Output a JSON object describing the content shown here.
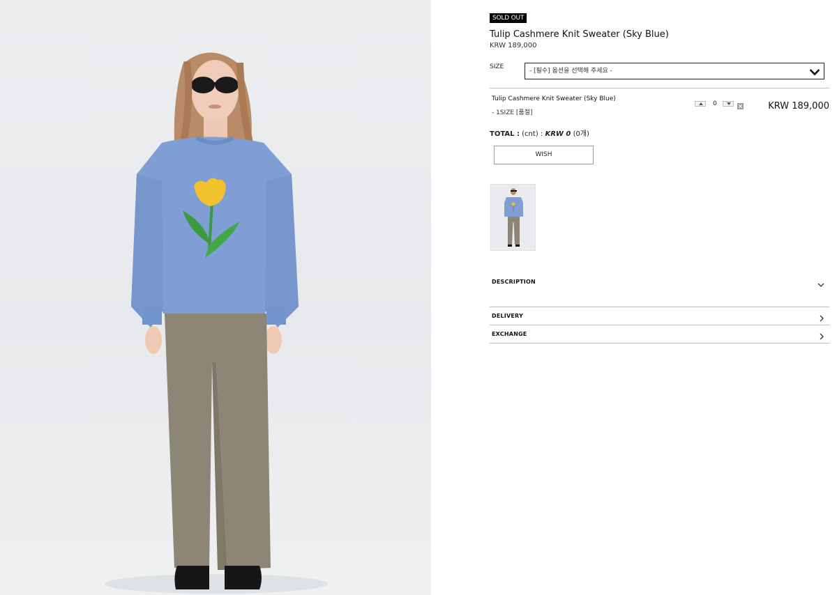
{
  "product": {
    "badge": "SOLD OUT",
    "title": "Tulip Cashmere Knit Sweater (Sky Blue)",
    "price": "KRW 189,000"
  },
  "size_option": {
    "label": "SIZE",
    "selected": "- [필수] 옵션을 선택해 주세요 -",
    "icon": "chevron-down-icon"
  },
  "selected_item": {
    "name": "Tulip Cashmere Knit Sweater (Sky Blue)",
    "option": "- 1SIZE [품절]",
    "quantity": "0",
    "price": "KRW 189,000"
  },
  "total": {
    "label": "TOTAL :",
    "count_note": "(cnt) :",
    "amount": "KRW 0",
    "count": "(0개)"
  },
  "actions": {
    "wish_label": "WISH"
  },
  "accordion": [
    {
      "label": "DESCRIPTION",
      "icon": "chevron-down-icon"
    },
    {
      "label": "DELIVERY",
      "icon": "chevron-right-icon"
    },
    {
      "label": "EXCHANGE",
      "icon": "chevron-right-icon"
    }
  ],
  "colors": {
    "sweater": "#7e9ed4",
    "tulip": "#f2c12e",
    "stem": "#3c9a42",
    "trousers": "#8d8677",
    "badge_bg": "#000000"
  }
}
